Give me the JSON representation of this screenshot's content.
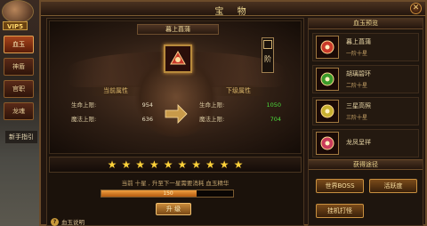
{
  "header": {
    "title": "宝 物",
    "close_icon": "✕"
  },
  "player": {
    "vip": "VIP5"
  },
  "side_tabs": [
    {
      "label": "血玉",
      "active": true
    },
    {
      "label": "神盾",
      "active": false
    },
    {
      "label": "官职",
      "active": false
    },
    {
      "label": "龙魂",
      "active": false
    }
  ],
  "side_extra": "新手指引",
  "display": {
    "item_name": "暮上菖蒲",
    "rank_label": "阶",
    "current_label": "当前属性",
    "next_label": "下级属性",
    "current": [
      {
        "label": "生命上限:",
        "value": "954"
      },
      {
        "label": "魔法上限:",
        "value": "636"
      }
    ],
    "next": [
      {
        "label": "生命上限:",
        "value": "1050"
      },
      {
        "label": "魔法上限:",
        "value": "704"
      }
    ]
  },
  "stars": {
    "count": 10,
    "filled": 10
  },
  "upgrade": {
    "hint": "当前 十星 , 升至下一星需要消耗 血玉精华",
    "progress_text": "150",
    "progress_fraction": 0.72,
    "button_label": "升 级"
  },
  "help": {
    "label": "血玉说明",
    "icon": "?"
  },
  "preview": {
    "title": "血玉预览",
    "items": [
      {
        "name": "暮上菖蒲",
        "grade": "一阶十星",
        "color": "#c83a2a"
      },
      {
        "name": "胡璃碧环",
        "grade": "二阶十星",
        "color": "#3a9a2a"
      },
      {
        "name": "三星高照",
        "grade": "三阶十星",
        "color": "#c8b030"
      },
      {
        "name": "龙凤呈祥",
        "grade": "",
        "color": "#c83a5a"
      }
    ]
  },
  "obtain": {
    "title": "获得途径",
    "buttons": [
      "世界BOSS",
      "活跃度",
      "挂机打怪"
    ]
  }
}
